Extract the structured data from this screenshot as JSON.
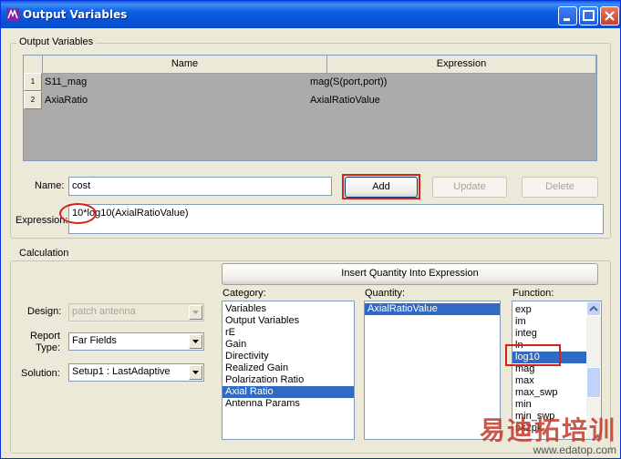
{
  "window": {
    "title": "Output Variables"
  },
  "output_variables": {
    "group_label": "Output Variables",
    "columns": [
      "Name",
      "Expression"
    ],
    "rows": [
      {
        "index": "1",
        "name": "S11_mag",
        "expression": "mag(S(port,port))"
      },
      {
        "index": "2",
        "name": "AxiaRatio",
        "expression": "AxialRatioValue"
      }
    ],
    "name_label": "Name:",
    "name_value": "cost",
    "expression_label": "Expression:",
    "expression_value": "10*log10(AxialRatioValue)",
    "buttons": {
      "add": "Add",
      "update": "Update",
      "delete": "Delete"
    }
  },
  "calculation": {
    "group_label": "Calculation",
    "insert_button": "Insert Quantity Into Expression",
    "design_label": "Design:",
    "design_value": "patch antenna",
    "report_type_label": "Report Type:",
    "report_type_value": "Far Fields",
    "solution_label": "Solution:",
    "solution_value": "Setup1 : LastAdaptive",
    "category_label": "Category:",
    "categories": [
      "Variables",
      "Output Variables",
      "rE",
      "Gain",
      "Directivity",
      "Realized Gain",
      "Polarization Ratio",
      "Axial Ratio",
      "Antenna Params"
    ],
    "selected_category": "Axial Ratio",
    "quantity_label": "Quantity:",
    "quantities": [
      "AxialRatioValue"
    ],
    "function_label": "Function:",
    "functions": [
      "exp",
      "im",
      "integ",
      "ln",
      "log10",
      "mag",
      "max",
      "max_swp",
      "min",
      "min_swp",
      "pk2pk"
    ],
    "selected_function": "log10"
  },
  "watermark": {
    "big": "易迪拓培训",
    "small": "www.edatop.com"
  },
  "colors": {
    "title_bar": "#0553d6",
    "selection": "#316ac5",
    "highlight": "#d32020",
    "dialog_bg": "#ece9d8"
  }
}
